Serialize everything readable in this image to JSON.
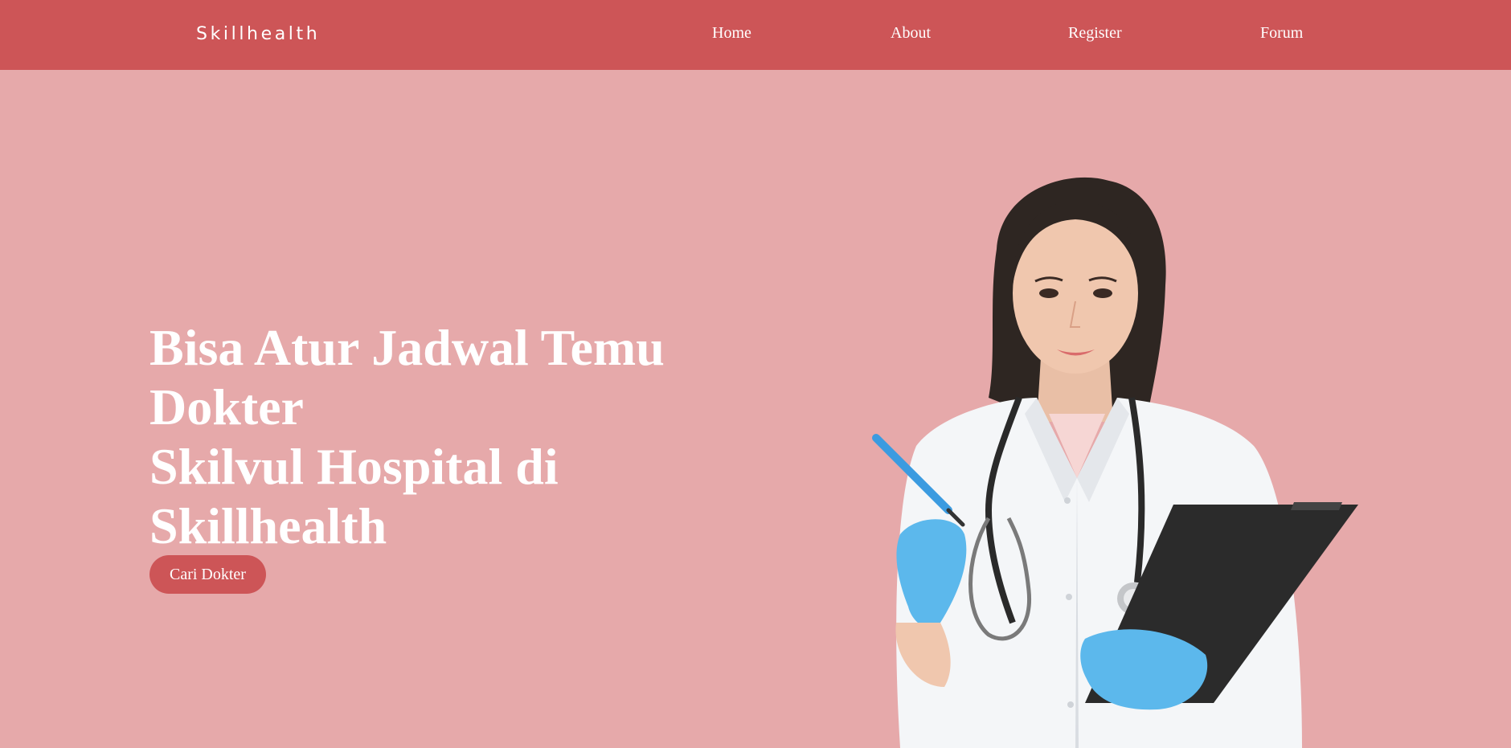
{
  "header": {
    "brand": "Skillhealth",
    "nav": [
      {
        "label": "Home"
      },
      {
        "label": "About"
      },
      {
        "label": "Register"
      },
      {
        "label": "Forum"
      }
    ]
  },
  "hero": {
    "headline_lines": [
      "Bisa Atur Jadwal Temu",
      "Dokter",
      "Skilvul Hospital di",
      "Skillhealth"
    ],
    "cta_label": "Cari Dokter",
    "illustration": "doctor-illustration"
  },
  "colors": {
    "nav_background": "#cd5557",
    "page_background": "#e6a9aa",
    "button_background": "#cd5557",
    "text": "#ffffff",
    "glove": "#5cb8ec",
    "clipboard": "#2b2b2b",
    "coat": "#f4f6f8",
    "hair": "#2e2622"
  }
}
